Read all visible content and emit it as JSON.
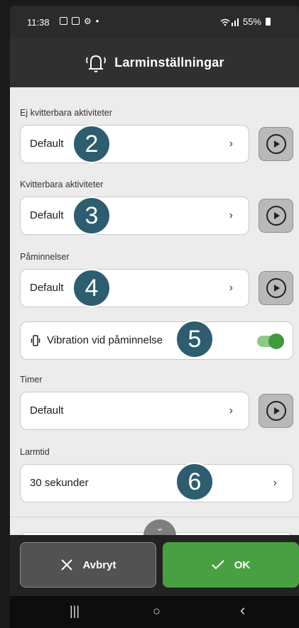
{
  "status": {
    "time": "11:38",
    "dot": "•",
    "battery": "55%"
  },
  "header": {
    "title": "Larminställningar"
  },
  "sections": {
    "ej_kvitterbara": {
      "label": "Ej kvitterbara aktiviteter",
      "value": "Default"
    },
    "kvitterbara": {
      "label": "Kvitterbara aktiviteter",
      "value": "Default"
    },
    "paminnelser": {
      "label": "Påminnelser",
      "value": "Default"
    },
    "vibration": {
      "label": "Vibration vid påminnelse",
      "enabled": true
    },
    "timer": {
      "label": "Timer",
      "value": "Default"
    },
    "larmtid": {
      "label": "Larmtid",
      "value": "30 sekunder"
    }
  },
  "badges": [
    "2",
    "3",
    "4",
    "5",
    "6"
  ],
  "chevron": "›",
  "footer": {
    "cancel": "Avbryt",
    "ok": "OK"
  },
  "navbar": {
    "recents": "|||",
    "home": "○",
    "back": "‹"
  },
  "colors": {
    "badge": "#2d5d6f",
    "ok": "#49a043",
    "header": "#303030",
    "toggle": "#3f9a3b"
  }
}
